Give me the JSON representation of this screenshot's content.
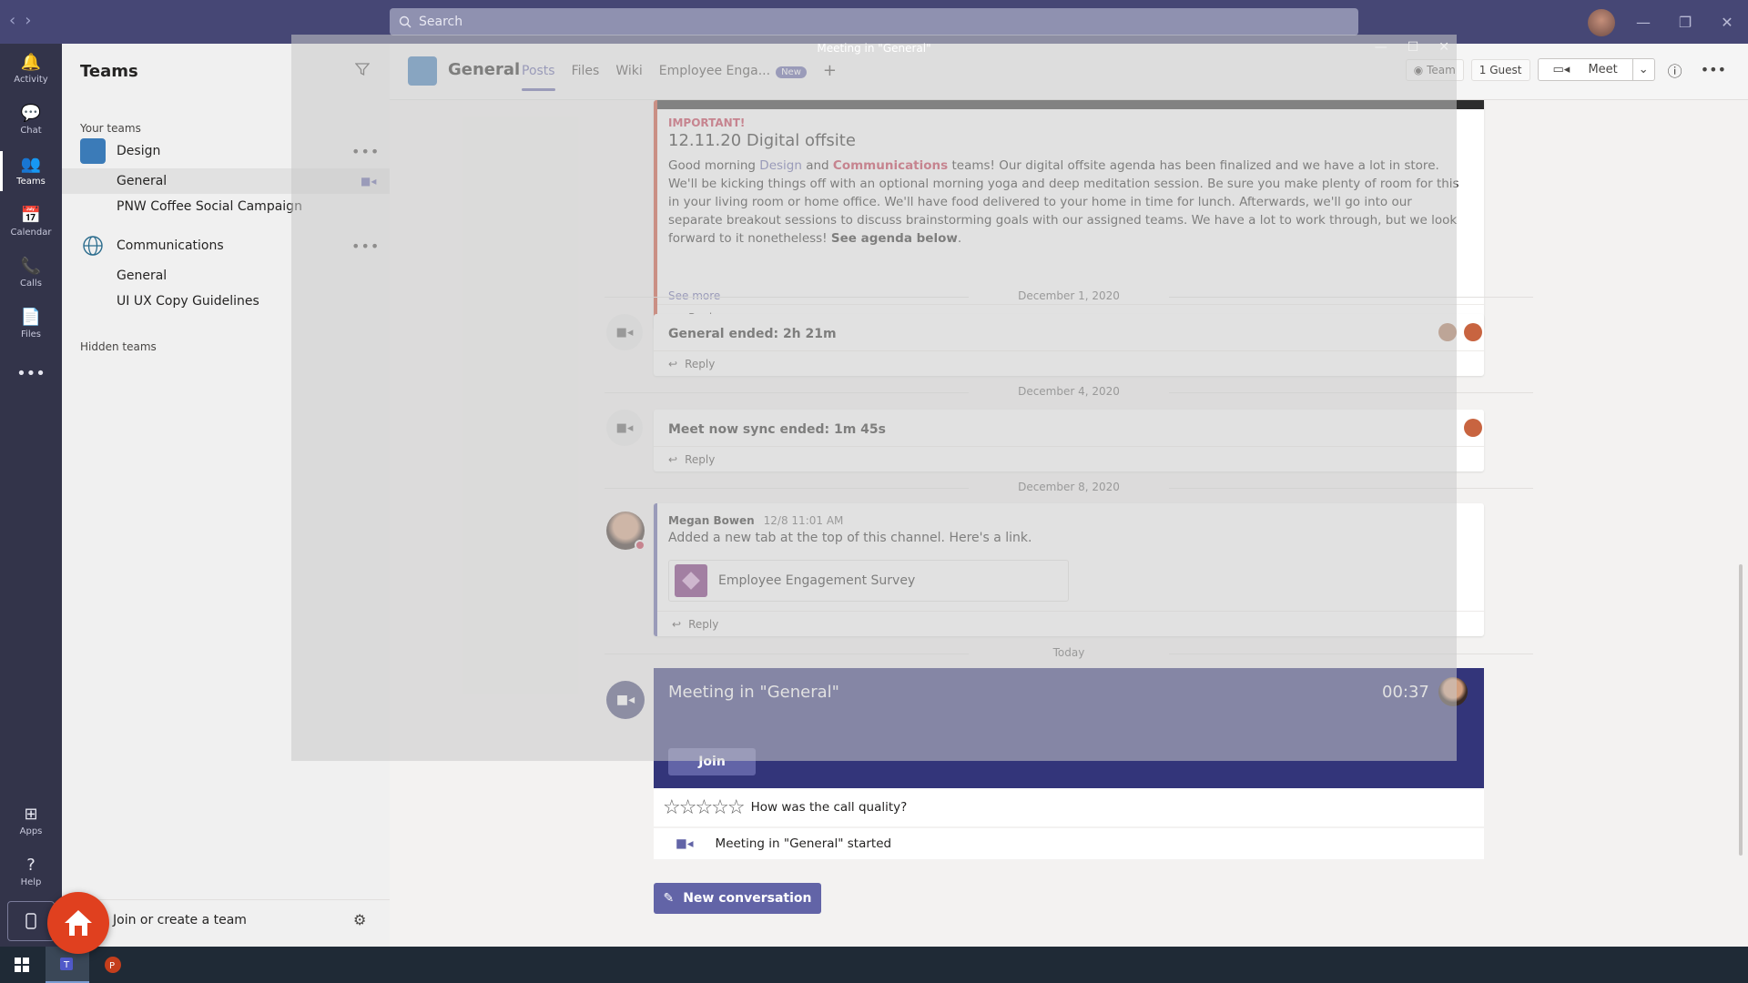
{
  "titlebar": {
    "search_placeholder": "Search",
    "back_icon": "‹",
    "forward_icon": "›",
    "window_controls": [
      "—",
      "❐",
      "✕"
    ]
  },
  "rail": {
    "items": [
      {
        "label": "Activity",
        "icon": "bell-icon",
        "glyph": "🔔"
      },
      {
        "label": "Chat",
        "icon": "chat-icon",
        "glyph": "💬"
      },
      {
        "label": "Teams",
        "icon": "teams-icon",
        "glyph": "👥"
      },
      {
        "label": "Calendar",
        "icon": "calendar-icon",
        "glyph": "📅"
      },
      {
        "label": "Calls",
        "icon": "phone-icon",
        "glyph": "📞"
      },
      {
        "label": "Files",
        "icon": "file-icon",
        "glyph": "📄"
      },
      {
        "label": "",
        "icon": "more-icon",
        "glyph": "•••"
      }
    ],
    "bottom": [
      {
        "label": "Apps",
        "icon": "apps-icon",
        "glyph": "⊞"
      },
      {
        "label": "Help",
        "icon": "help-icon",
        "glyph": "?"
      }
    ]
  },
  "teams_panel": {
    "title": "Teams",
    "your_teams_label": "Your teams",
    "hidden_teams_label": "Hidden teams",
    "teams": [
      {
        "name": "Design",
        "channels": [
          "General",
          "PNW Coffee Social Campaign"
        ]
      },
      {
        "name": "Communications",
        "channels": [
          "General",
          "UI UX Copy Guidelines"
        ]
      }
    ],
    "join_create_label": "Join or create a team"
  },
  "channel": {
    "title": "General",
    "tabs": [
      {
        "label": "Posts"
      },
      {
        "label": "Files"
      },
      {
        "label": "Wiki"
      },
      {
        "label": "Employee Enga..."
      }
    ],
    "new_badge": "New",
    "team_label": "Team",
    "guest_label": "1 Guest",
    "meet_label": "Meet"
  },
  "posts": {
    "announcement": {
      "important": "IMPORTANT!",
      "title": "12.11.20 Digital offsite",
      "body_pre": "Good morning ",
      "design_link": "Design",
      "and": " and ",
      "comms_link": "Communications",
      "body_post": " teams! Our digital offsite agenda has been finalized and we have a lot in store. We'll be kicking things off with an optional morning yoga and deep meditation session. Be sure you make plenty of room for this in your living room or home office. We'll have food delivered to your home in time for lunch. Afterwards, we'll go into our separate breakout sessions to discuss brainstorming goals with our assigned teams. We have a lot to work through, but we look forward to it nonetheless! ",
      "bold_end": "See agenda below",
      "period": ".",
      "see_more": "See more",
      "reply": "Reply"
    },
    "date1": "December 1, 2020",
    "meeting1": {
      "text": "General ended: 2h 21m",
      "reply": "Reply"
    },
    "date2": "December 4, 2020",
    "meeting2": {
      "text": "Meet now sync ended: 1m 45s",
      "reply": "Reply"
    },
    "date3": "December 8, 2020",
    "megan": {
      "author": "Megan Bowen",
      "time": "12/8 11:01 AM",
      "message": "Added a new tab at the top of this channel. Here's a link.",
      "tab_card": "Employee Engagement Survey",
      "reply": "Reply"
    },
    "date4": "Today",
    "live_meeting": {
      "title": "Meeting in \"General\"",
      "timer": "00:37",
      "join": "Join",
      "rating_question": "How was the call quality?",
      "stars": "☆☆☆☆☆",
      "started": "Meeting in \"General\" started"
    },
    "new_conversation": "New conversation"
  },
  "overlay": {
    "title": "Meeting in \"General\""
  },
  "colors": {
    "titlebar": "#464775",
    "rail": "#33344a",
    "accent": "#6264a7",
    "meeting_card": "#33357a",
    "important": "#c4314b",
    "home_button": "#e0401f"
  }
}
